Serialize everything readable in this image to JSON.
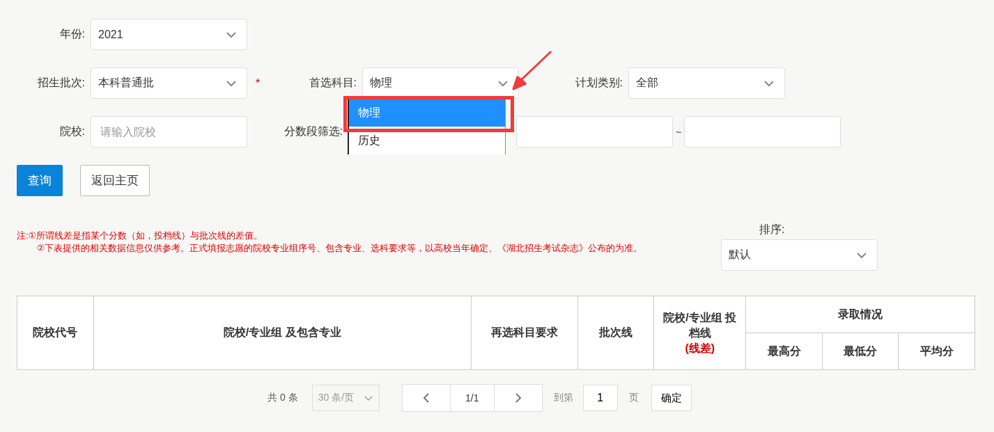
{
  "filters": {
    "year": {
      "label": "年份:",
      "value": "2021"
    },
    "batch": {
      "label": "招生批次:",
      "value": "本科普通批",
      "required_mark": "*"
    },
    "subject": {
      "label": "首选科目:",
      "value": "物理",
      "expanded": true,
      "options": [
        {
          "label": "物理",
          "selected": true
        },
        {
          "label": "历史",
          "selected": false
        }
      ]
    },
    "plan_type": {
      "label": "计划类别:",
      "value": "全部"
    },
    "school": {
      "label": "院校:",
      "placeholder": "请输入院校"
    },
    "score_range": {
      "label": "分数段筛选:",
      "separator": "~"
    }
  },
  "buttons": [
    {
      "label": "查询",
      "kind": "primary"
    },
    {
      "label": "返回主页",
      "kind": "plain"
    }
  ],
  "notes": [
    "注:①所谓线差是指某个分数（如，投档线）与批次线的差值。",
    "②下表提供的相关数据信息仅供参考。正式填报志愿的院校专业组序号、包含专业、选科要求等，以高校当年确定、《湖北招生考试杂志》公布的为准。"
  ],
  "sort": {
    "label": "排序:",
    "value": "默认"
  },
  "table": {
    "columns": [
      {
        "label": "院校代号"
      },
      {
        "label": "院校/专业组 及包含专业"
      },
      {
        "label": "再选科目要求"
      },
      {
        "label": "批次线"
      },
      {
        "label": "院校/专业组 投档线",
        "note": "(线差)"
      },
      {
        "label": "录取情况",
        "children": [
          {
            "label": "最高分"
          },
          {
            "label": "最低分"
          },
          {
            "label": "平均分"
          }
        ]
      }
    ]
  },
  "pagination": {
    "total": "共 0 条",
    "page_size": "30 条/页",
    "page": "1/1",
    "goto_label": "到第",
    "goto_value": "1",
    "page_unit": "页",
    "confirm": "确定"
  }
}
